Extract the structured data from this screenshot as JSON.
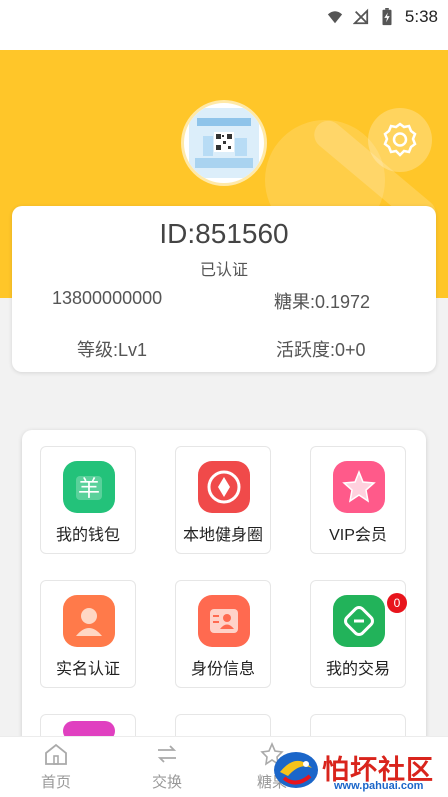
{
  "status_bar": {
    "time": "5:38"
  },
  "profile": {
    "id_text": "ID:851560",
    "verification": "已认证",
    "phone": "13800000000",
    "candy": "糖果:0.1972",
    "level": "等级:Lv1",
    "activity": "活跃度:0+0"
  },
  "menu": {
    "items": [
      {
        "label": "我的钱包",
        "icon": "wallet-icon",
        "color": "#23c27a"
      },
      {
        "label": "本地健身圈",
        "icon": "fitness-circle-icon",
        "color": "#f04a4a"
      },
      {
        "label": "VIP会员",
        "icon": "vip-star-icon",
        "color": "#ff5a8a"
      },
      {
        "label": "实名认证",
        "icon": "real-name-icon",
        "color": "#ff7a4a"
      },
      {
        "label": "身份信息",
        "icon": "id-info-icon",
        "color": "#ff6a50"
      },
      {
        "label": "我的交易",
        "icon": "transaction-icon",
        "color": "#22b35a",
        "badge": "0"
      }
    ]
  },
  "tabbar": {
    "items": [
      {
        "label": "首页",
        "icon": "home-icon"
      },
      {
        "label": "交换",
        "icon": "exchange-icon"
      },
      {
        "label": "糖果",
        "icon": "candy-icon"
      }
    ]
  },
  "watermark": {
    "text": "怕坏社区",
    "url": "www.pahuai.com"
  },
  "colors": {
    "header_bg": "#ffc629",
    "badge": "#e8141c"
  }
}
